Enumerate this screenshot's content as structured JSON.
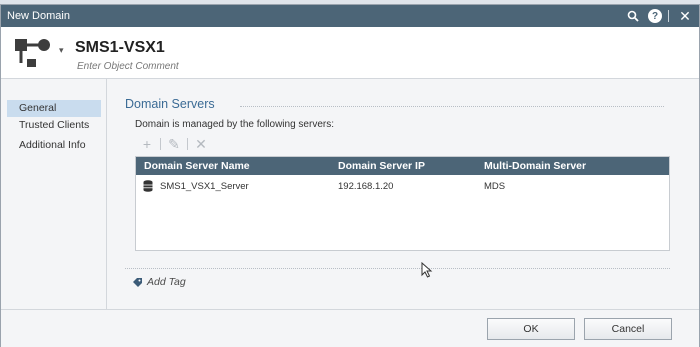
{
  "window": {
    "title": "New Domain"
  },
  "titlebar": {
    "help_icon": "?",
    "close_icon": "✕"
  },
  "header": {
    "object_name": "SMS1-VSX1",
    "comment_placeholder": "Enter Object Comment"
  },
  "sidebar": {
    "items": [
      {
        "label": "General",
        "selected": true
      },
      {
        "label": "Trusted Clients",
        "selected": false
      },
      {
        "label": "Additional Info",
        "selected": false
      }
    ]
  },
  "domain_servers": {
    "section_title": "Domain Servers",
    "description": "Domain is managed by the following servers:",
    "toolbar": {
      "add": "+",
      "edit": "✎",
      "remove": "✕"
    },
    "columns": [
      "Domain Server Name",
      "Domain Server IP",
      "Multi-Domain Server"
    ],
    "rows": [
      {
        "name": "SMS1_VSX1_Server",
        "ip": "192.168.1.20",
        "mds": "MDS"
      }
    ]
  },
  "tags": {
    "add_label": "Add Tag"
  },
  "buttons": {
    "ok": "OK",
    "cancel": "Cancel"
  },
  "colors": {
    "titlebar": "#4c6577",
    "section_title": "#3b6b95",
    "selected_item": "#c9dcee"
  }
}
